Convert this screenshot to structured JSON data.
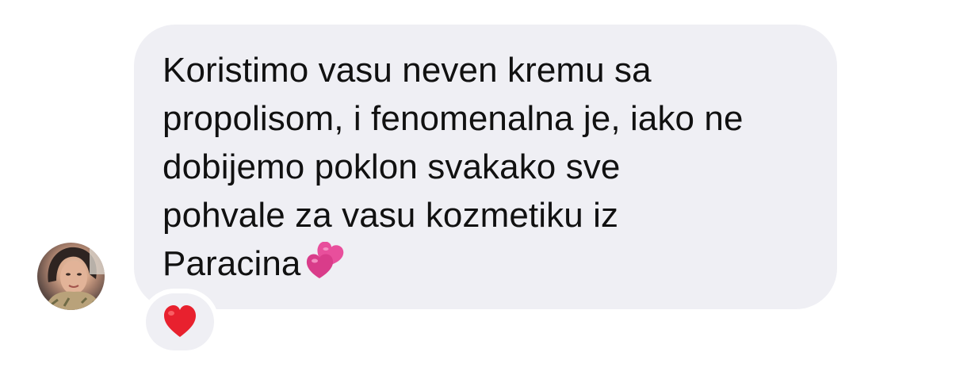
{
  "message": {
    "lines": [
      "Koristimo vasu neven kremu sa",
      "propolisom, i fenomenalna je, iako ne",
      "dobijemo poklon svakako sve",
      "pohvale za vasu kozmetiku iz",
      "Paracina"
    ],
    "line1": "Koristimo vasu neven kremu sa",
    "line2": "propolisom, i fenomenalna je, iako ne",
    "line3": "dobijemo poklon svakako sve",
    "line4": "pohvale za vasu kozmetiku iz",
    "line5": "Paracina",
    "trailing_emoji": "two-hearts-icon"
  },
  "reaction": {
    "emoji": "red-heart-icon"
  },
  "colors": {
    "bubble": "#efeff4",
    "text": "#111111",
    "heart": "#e8212e",
    "hearts_pink": "#e84f9c"
  }
}
